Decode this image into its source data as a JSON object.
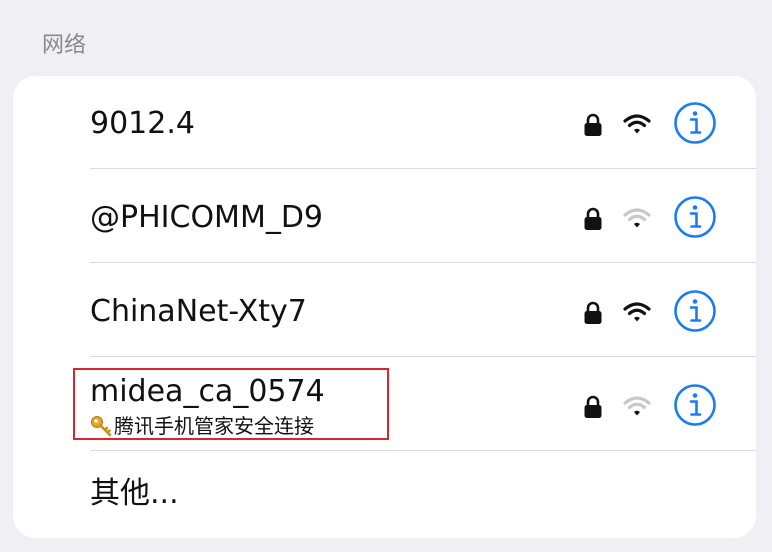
{
  "section_header": "网络",
  "networks": [
    {
      "ssid": "9012.4",
      "secured": true,
      "signal": "medium"
    },
    {
      "ssid": "@PHICOMM_D9",
      "secured": true,
      "signal": "weak"
    },
    {
      "ssid": "ChinaNet-Xty7",
      "secured": true,
      "signal": "full"
    },
    {
      "ssid": "midea_ca_0574",
      "subtitle": "腾讯手机管家安全连接",
      "secured": true,
      "signal": "weak",
      "highlighted": true
    }
  ],
  "other_label": "其他...",
  "icons": {
    "lock": "lock-icon",
    "wifi": "wifi-signal-icon",
    "info": "info-icon",
    "key": "key-icon"
  },
  "colors": {
    "accent_blue": "#1a7cf5",
    "highlight_red": "#d6262e"
  }
}
